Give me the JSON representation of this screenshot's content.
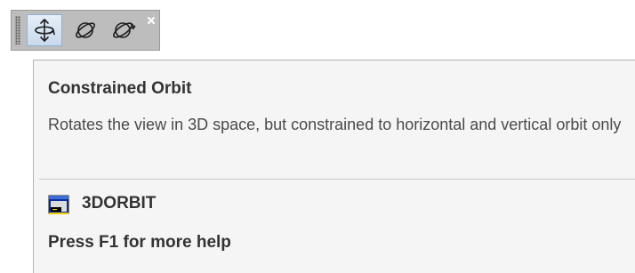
{
  "toolbar": {
    "buttons": [
      {
        "icon": "constrained-orbit-icon",
        "active": true
      },
      {
        "icon": "free-orbit-icon",
        "active": false
      },
      {
        "icon": "continuous-orbit-icon",
        "active": false
      }
    ],
    "close_icon": "close-icon"
  },
  "tooltip": {
    "title": "Constrained Orbit",
    "description": "Rotates the view in 3D space, but constrained to horizontal and vertical orbit only",
    "command_icon": "command-window-icon",
    "command": "3DORBIT",
    "help": "Press F1 for more help"
  },
  "colors": {
    "toolbar_bg": "#bdbdbd",
    "tooltip_bg": "#f5f5f5",
    "active_button_border": "#8fb0d4",
    "text": "#333333"
  }
}
